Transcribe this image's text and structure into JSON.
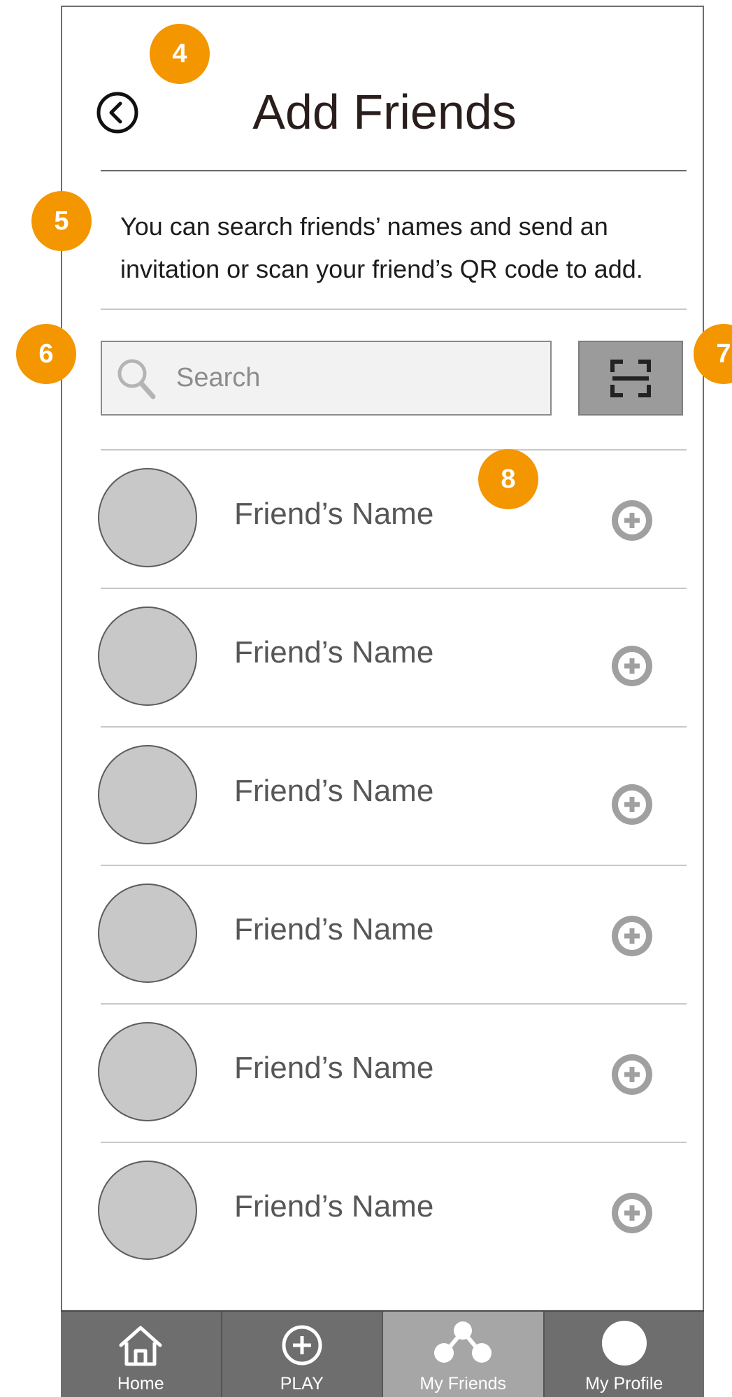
{
  "header": {
    "title": "Add Friends",
    "back_icon": "chevron-left-circle-icon"
  },
  "description": {
    "line1": "You can search friends’ names and send an",
    "line2": "invitation or scan your friend’s QR code to add."
  },
  "search": {
    "placeholder": "Search",
    "value": "",
    "icon": "search-icon"
  },
  "scan": {
    "icon": "qr-scan-icon"
  },
  "friends": [
    {
      "name": "Friend’s Name"
    },
    {
      "name": "Friend’s Name"
    },
    {
      "name": "Friend’s Name"
    },
    {
      "name": "Friend’s Name"
    },
    {
      "name": "Friend’s Name"
    },
    {
      "name": "Friend’s Name"
    }
  ],
  "badges": {
    "b4": "4",
    "b5": "5",
    "b6": "6",
    "b7": "7",
    "b8": "8"
  },
  "tabbar": {
    "home": "Home",
    "play": "PLAY",
    "friends": "My Friends",
    "profile": "My Profile"
  },
  "colors": {
    "accent_badge": "#f39600",
    "tab_bg": "#6e6e6e",
    "tab_active": "#a6a6a6",
    "avatar": "#c8c8c8"
  }
}
